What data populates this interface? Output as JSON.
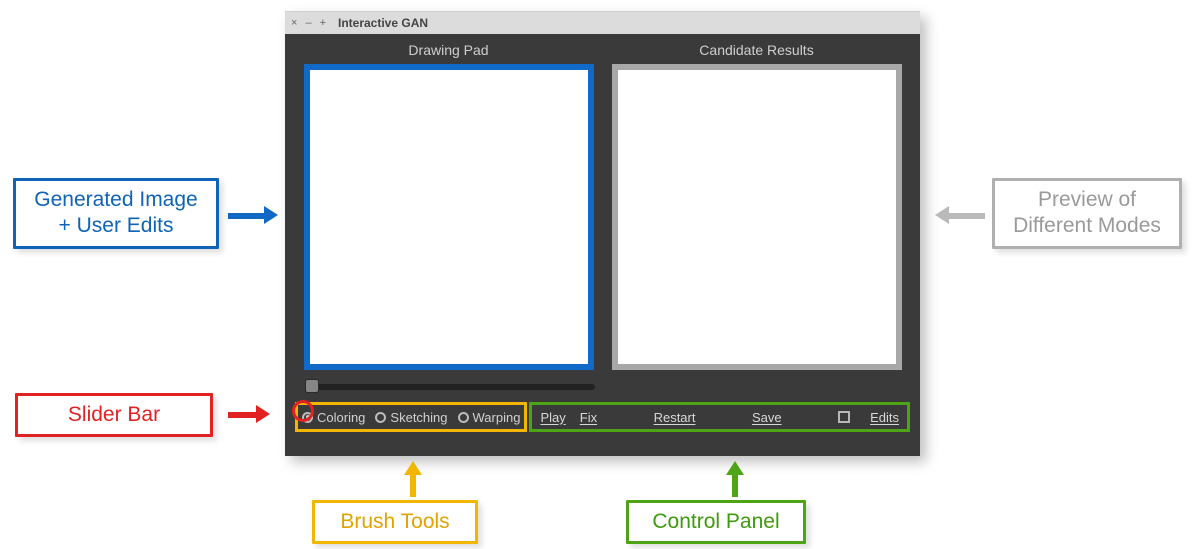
{
  "window": {
    "title": "Interactive GAN",
    "close_icon": "×",
    "min_icon": "–",
    "max_icon": "+"
  },
  "panels": {
    "drawing_pad_label": "Drawing Pad",
    "candidate_results_label": "Candidate Results"
  },
  "brush": {
    "coloring": "Coloring",
    "sketching": "Sketching",
    "warping": "Warping"
  },
  "controls": {
    "play": "Play",
    "fix": "Fix",
    "restart": "Restart",
    "save": "Save",
    "edits": "Edits"
  },
  "callouts": {
    "generated": "Generated Image\n+ User Edits",
    "slider": "Slider Bar",
    "preview": "Preview of\nDifferent Modes",
    "brush_tools": "Brush Tools",
    "control_panel": "Control Panel"
  }
}
